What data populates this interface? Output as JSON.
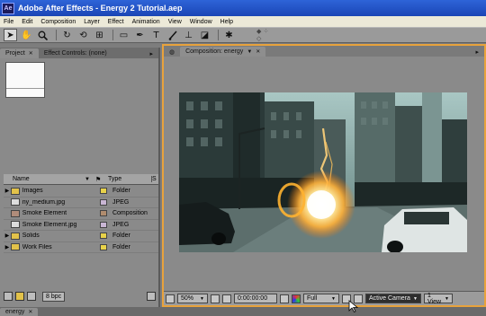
{
  "window": {
    "title": "Adobe After Effects - Energy 2 Tutorial.aep",
    "logo_text": "Ae"
  },
  "menu": [
    "File",
    "Edit",
    "Composition",
    "Layer",
    "Effect",
    "Animation",
    "View",
    "Window",
    "Help"
  ],
  "tools": [
    {
      "name": "selection-tool-icon",
      "glyph": "➤"
    },
    {
      "name": "hand-tool-icon",
      "glyph": "✋"
    },
    {
      "name": "zoom-tool-icon",
      "glyph": "🔍"
    },
    {
      "name": "rotate-tool-icon",
      "glyph": "↻"
    },
    {
      "name": "camera-orbit-tool-icon",
      "glyph": "⟲"
    },
    {
      "name": "pan-behind-tool-icon",
      "glyph": "⊞"
    },
    {
      "name": "rectangle-mask-tool-icon",
      "glyph": "▭"
    },
    {
      "name": "pen-tool-icon",
      "glyph": "✒"
    },
    {
      "name": "type-tool-icon",
      "glyph": "T"
    },
    {
      "name": "brush-tool-icon",
      "glyph": "/"
    },
    {
      "name": "clone-stamp-tool-icon",
      "glyph": "⊥"
    },
    {
      "name": "eraser-tool-icon",
      "glyph": "◪"
    },
    {
      "name": "puppet-pin-tool-icon",
      "glyph": "✱"
    }
  ],
  "project_panel": {
    "tabs": [
      "Project",
      "Effect Controls: (none)"
    ],
    "columns": {
      "name": "Name",
      "type": "Type"
    },
    "items": [
      {
        "name": "Images",
        "type": "Folder",
        "kind": "folder",
        "label_color": "#e8d24a",
        "expandable": true
      },
      {
        "name": "ny_medium.jpg",
        "type": "JPEG",
        "kind": "file",
        "label_color": "#c9b6d4",
        "expandable": false
      },
      {
        "name": "Smoke Element",
        "type": "Composition",
        "kind": "comp",
        "label_color": "#b08c6e",
        "expandable": false
      },
      {
        "name": "Smoke Element.jpg",
        "type": "JPEG",
        "kind": "file",
        "label_color": "#c9b6d4",
        "expandable": false
      },
      {
        "name": "Solids",
        "type": "Folder",
        "kind": "folder",
        "label_color": "#e8d24a",
        "expandable": true
      },
      {
        "name": "Work Files",
        "type": "Folder",
        "kind": "folder",
        "label_color": "#e8d24a",
        "expandable": true
      }
    ],
    "footer": {
      "bpc": "8 bpc"
    }
  },
  "comp_panel": {
    "tab": "Composition: energy",
    "footer": {
      "zoom": "50%",
      "timecode": "0:00:00:00",
      "resolution": "Full",
      "camera": "Active Camera",
      "views": "1 View"
    }
  },
  "timeline": {
    "tab": "energy"
  },
  "colors": {
    "accent": "#e8a23c",
    "titlebar": "#1f4fc4",
    "panel": "#8a8a8a"
  }
}
